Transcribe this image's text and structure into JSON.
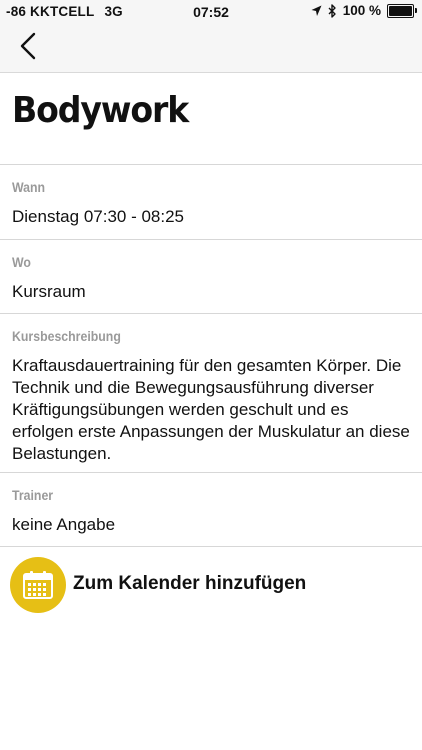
{
  "status_bar": {
    "carrier": "-86 KKTCELL",
    "network": "3G",
    "time": "07:52",
    "battery_percent": "100 %",
    "battery_level": 1.0
  },
  "nav": {
    "back_icon": "chevron-left-icon"
  },
  "page": {
    "title": "Bodywork"
  },
  "details": {
    "when": {
      "label": "Wann",
      "value": "Dienstag 07:30 - 08:25"
    },
    "where": {
      "label": "Wo",
      "value": "Kursraum"
    },
    "description": {
      "label": "Kursbeschreibung",
      "value": "Kraftausdauertraining für den gesamten Körper. Die Technik und die Bewegungsausführung diverser Kräftigungsübungen werden geschult und es erfolgen erste Anpassungen der Muskulatur an diese Belastungen."
    },
    "trainer": {
      "label": "Trainer",
      "value": "keine Angabe"
    }
  },
  "calendar_action": {
    "label": "Zum Kalender hinzufügen",
    "icon": "calendar-icon",
    "accent_color": "#e6bf15"
  }
}
